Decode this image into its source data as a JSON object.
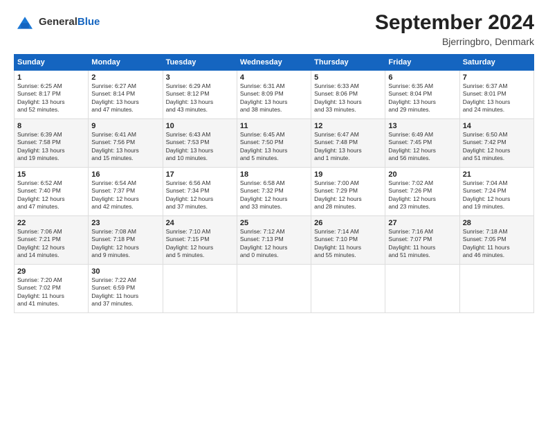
{
  "header": {
    "logo_general": "General",
    "logo_blue": "Blue",
    "month_year": "September 2024",
    "location": "Bjerringbro, Denmark"
  },
  "weekdays": [
    "Sunday",
    "Monday",
    "Tuesday",
    "Wednesday",
    "Thursday",
    "Friday",
    "Saturday"
  ],
  "weeks": [
    [
      {
        "day": "1",
        "info": "Sunrise: 6:25 AM\nSunset: 8:17 PM\nDaylight: 13 hours\nand 52 minutes."
      },
      {
        "day": "2",
        "info": "Sunrise: 6:27 AM\nSunset: 8:14 PM\nDaylight: 13 hours\nand 47 minutes."
      },
      {
        "day": "3",
        "info": "Sunrise: 6:29 AM\nSunset: 8:12 PM\nDaylight: 13 hours\nand 43 minutes."
      },
      {
        "day": "4",
        "info": "Sunrise: 6:31 AM\nSunset: 8:09 PM\nDaylight: 13 hours\nand 38 minutes."
      },
      {
        "day": "5",
        "info": "Sunrise: 6:33 AM\nSunset: 8:06 PM\nDaylight: 13 hours\nand 33 minutes."
      },
      {
        "day": "6",
        "info": "Sunrise: 6:35 AM\nSunset: 8:04 PM\nDaylight: 13 hours\nand 29 minutes."
      },
      {
        "day": "7",
        "info": "Sunrise: 6:37 AM\nSunset: 8:01 PM\nDaylight: 13 hours\nand 24 minutes."
      }
    ],
    [
      {
        "day": "8",
        "info": "Sunrise: 6:39 AM\nSunset: 7:58 PM\nDaylight: 13 hours\nand 19 minutes."
      },
      {
        "day": "9",
        "info": "Sunrise: 6:41 AM\nSunset: 7:56 PM\nDaylight: 13 hours\nand 15 minutes."
      },
      {
        "day": "10",
        "info": "Sunrise: 6:43 AM\nSunset: 7:53 PM\nDaylight: 13 hours\nand 10 minutes."
      },
      {
        "day": "11",
        "info": "Sunrise: 6:45 AM\nSunset: 7:50 PM\nDaylight: 13 hours\nand 5 minutes."
      },
      {
        "day": "12",
        "info": "Sunrise: 6:47 AM\nSunset: 7:48 PM\nDaylight: 13 hours\nand 1 minute."
      },
      {
        "day": "13",
        "info": "Sunrise: 6:49 AM\nSunset: 7:45 PM\nDaylight: 12 hours\nand 56 minutes."
      },
      {
        "day": "14",
        "info": "Sunrise: 6:50 AM\nSunset: 7:42 PM\nDaylight: 12 hours\nand 51 minutes."
      }
    ],
    [
      {
        "day": "15",
        "info": "Sunrise: 6:52 AM\nSunset: 7:40 PM\nDaylight: 12 hours\nand 47 minutes."
      },
      {
        "day": "16",
        "info": "Sunrise: 6:54 AM\nSunset: 7:37 PM\nDaylight: 12 hours\nand 42 minutes."
      },
      {
        "day": "17",
        "info": "Sunrise: 6:56 AM\nSunset: 7:34 PM\nDaylight: 12 hours\nand 37 minutes."
      },
      {
        "day": "18",
        "info": "Sunrise: 6:58 AM\nSunset: 7:32 PM\nDaylight: 12 hours\nand 33 minutes."
      },
      {
        "day": "19",
        "info": "Sunrise: 7:00 AM\nSunset: 7:29 PM\nDaylight: 12 hours\nand 28 minutes."
      },
      {
        "day": "20",
        "info": "Sunrise: 7:02 AM\nSunset: 7:26 PM\nDaylight: 12 hours\nand 23 minutes."
      },
      {
        "day": "21",
        "info": "Sunrise: 7:04 AM\nSunset: 7:24 PM\nDaylight: 12 hours\nand 19 minutes."
      }
    ],
    [
      {
        "day": "22",
        "info": "Sunrise: 7:06 AM\nSunset: 7:21 PM\nDaylight: 12 hours\nand 14 minutes."
      },
      {
        "day": "23",
        "info": "Sunrise: 7:08 AM\nSunset: 7:18 PM\nDaylight: 12 hours\nand 9 minutes."
      },
      {
        "day": "24",
        "info": "Sunrise: 7:10 AM\nSunset: 7:15 PM\nDaylight: 12 hours\nand 5 minutes."
      },
      {
        "day": "25",
        "info": "Sunrise: 7:12 AM\nSunset: 7:13 PM\nDaylight: 12 hours\nand 0 minutes."
      },
      {
        "day": "26",
        "info": "Sunrise: 7:14 AM\nSunset: 7:10 PM\nDaylight: 11 hours\nand 55 minutes."
      },
      {
        "day": "27",
        "info": "Sunrise: 7:16 AM\nSunset: 7:07 PM\nDaylight: 11 hours\nand 51 minutes."
      },
      {
        "day": "28",
        "info": "Sunrise: 7:18 AM\nSunset: 7:05 PM\nDaylight: 11 hours\nand 46 minutes."
      }
    ],
    [
      {
        "day": "29",
        "info": "Sunrise: 7:20 AM\nSunset: 7:02 PM\nDaylight: 11 hours\nand 41 minutes."
      },
      {
        "day": "30",
        "info": "Sunrise: 7:22 AM\nSunset: 6:59 PM\nDaylight: 11 hours\nand 37 minutes."
      },
      {
        "day": "",
        "info": ""
      },
      {
        "day": "",
        "info": ""
      },
      {
        "day": "",
        "info": ""
      },
      {
        "day": "",
        "info": ""
      },
      {
        "day": "",
        "info": ""
      }
    ]
  ]
}
